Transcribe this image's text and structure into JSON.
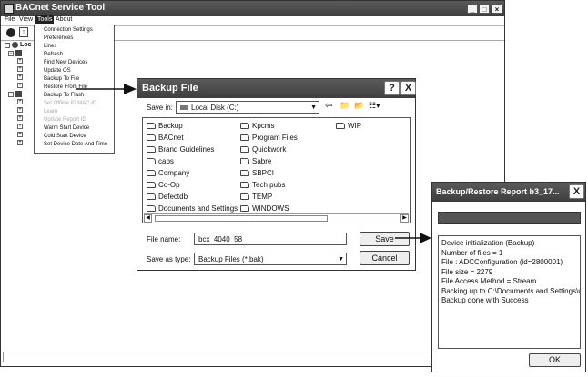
{
  "main_window": {
    "title": "BACnet Service Tool",
    "menu": [
      "File",
      "View",
      "Tools",
      "About"
    ],
    "tree_root_label": "Loc"
  },
  "tools_menu": {
    "items": [
      {
        "label": "Connection Settings",
        "enabled": true
      },
      {
        "label": "Preferences",
        "enabled": true
      },
      {
        "label": "Lines",
        "enabled": true
      },
      {
        "label": "Refresh",
        "enabled": true
      },
      {
        "label": "Find New Devices",
        "enabled": true
      },
      {
        "label": "Update OS",
        "enabled": true
      },
      {
        "label": "Backup To File",
        "enabled": true
      },
      {
        "label": "Restore From File",
        "enabled": true
      },
      {
        "label": "Backup To Flash",
        "enabled": true
      },
      {
        "label": "Set Offline ID MAC ID",
        "enabled": false
      },
      {
        "label": "Learn",
        "enabled": false
      },
      {
        "label": "Update Report ID",
        "enabled": false
      },
      {
        "label": "Warm Start Device",
        "enabled": true
      },
      {
        "label": "Cold Start Device",
        "enabled": true
      },
      {
        "label": "Set Device Date And Time",
        "enabled": true
      }
    ]
  },
  "backup_dialog": {
    "title": "Backup File",
    "save_in_label": "Save in:",
    "save_in_value": "Local Disk (C:)",
    "folders": [
      "Backup",
      "BACnet",
      "Brand Guidelines",
      "cabs",
      "Company",
      "Co-Op",
      "Defectdb",
      "Documents and Settings",
      "Kpcms",
      "Program Files",
      "Quickwork",
      "Sabre",
      "SBPCI",
      "Tech pubs",
      "TEMP",
      "WINDOWS",
      "WIP"
    ],
    "file_name_label": "File name:",
    "file_name_value": "bcx_4040_58",
    "save_type_label": "Save as type:",
    "save_type_value": "Backup Files (*.bak)",
    "save_button": "Save",
    "cancel_button": "Cancel",
    "help_button": "?",
    "close_button": "X"
  },
  "report_dialog": {
    "title": "Backup/Restore Report b3_17...",
    "lines": [
      "Device initialization (Backup)",
      "Number of files = 1",
      "File : ADCConfiguration (id=2800001)",
      "File size = 2279",
      "File Access Method = Stream",
      "Backing up to C:\\Documents and Settings\\u",
      "Backup done with Success"
    ],
    "ok_button": "OK",
    "close_button": "X"
  }
}
